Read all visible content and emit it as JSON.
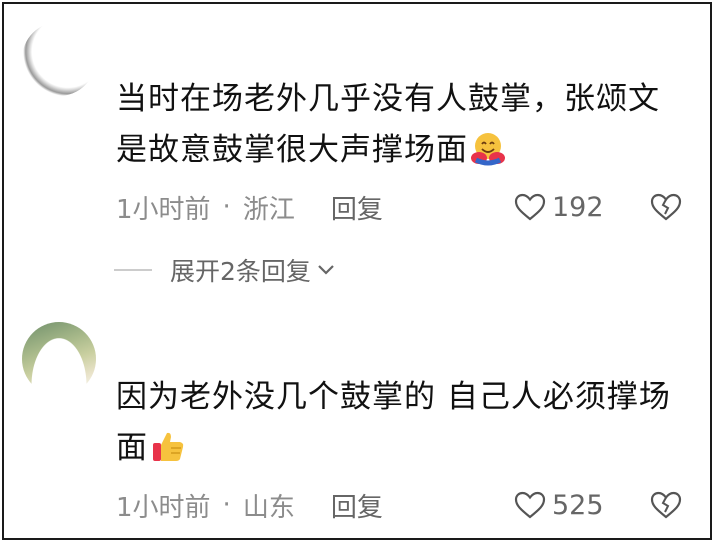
{
  "comments": [
    {
      "text": "当时在场老外几乎没有人鼓掌，张颂文是故意鼓掌很大声撑场面",
      "emoji": "hugging-face-icon",
      "time": "1小时前",
      "location": "浙江",
      "reply_label": "回复",
      "likes": "192"
    },
    {
      "text": "因为老外没几个鼓掌的 自己人必须撑场面",
      "emoji": "thumbs-up-icon",
      "time": "1小时前",
      "location": "山东",
      "reply_label": "回复",
      "likes": "525"
    }
  ],
  "expand_replies_label": "展开2条回复",
  "separator": "·"
}
